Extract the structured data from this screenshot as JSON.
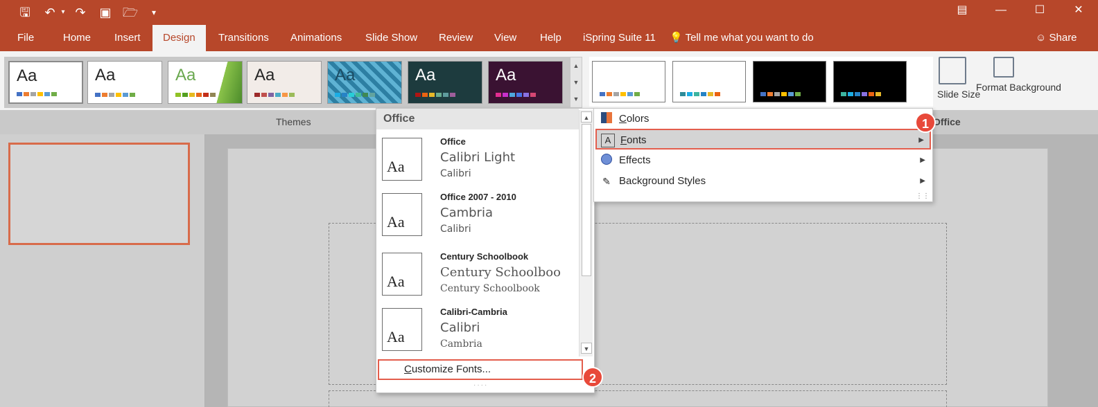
{
  "tabs": [
    "File",
    "Home",
    "Insert",
    "Design",
    "Transitions",
    "Animations",
    "Slide Show",
    "Review",
    "View",
    "Help",
    "iSpring Suite 11"
  ],
  "active_tab": "Design",
  "tell_me": "Tell me what you want to do",
  "share": "Share",
  "ribbon": {
    "themes_label": "Themes",
    "variants_label": "Office",
    "slide_size": "Slide Size",
    "format_background": "Format Background",
    "theme_aa": [
      "Aa",
      "Aa",
      "Aa",
      "Aa",
      "Aa",
      "Aa",
      "Aa"
    ]
  },
  "fonts_menu": {
    "header": "Office",
    "items": [
      {
        "name": "Office",
        "heading": "Calibri Light",
        "body": "Calibri",
        "sample": "Aa"
      },
      {
        "name": "Office 2007 - 2010",
        "heading": "Cambria",
        "body": "Calibri",
        "sample": "Aa"
      },
      {
        "name": "Century Schoolbook",
        "heading": "Century Schoolboo",
        "body": "Century Schoolbook",
        "sample": "Aa"
      },
      {
        "name": "Calibri-Cambria",
        "heading": "Calibri",
        "body": "Cambria",
        "sample": "Aa"
      }
    ],
    "customize_first": "C",
    "customize_rest": "ustomize Fonts..."
  },
  "design_menu": {
    "items": [
      {
        "first": "C",
        "rest": "olors",
        "icon": "colors-icon"
      },
      {
        "first": "F",
        "rest": "onts",
        "icon": "fonts-icon"
      },
      {
        "first": "",
        "rest": "Effects",
        "icon": "effects-icon"
      },
      {
        "first": "",
        "rest": "Background Styles",
        "icon": "background-styles-icon"
      }
    ]
  },
  "badges": [
    "1",
    "2"
  ],
  "colors": {
    "accent": "#b7472a",
    "highlight": "#e35d4c"
  }
}
